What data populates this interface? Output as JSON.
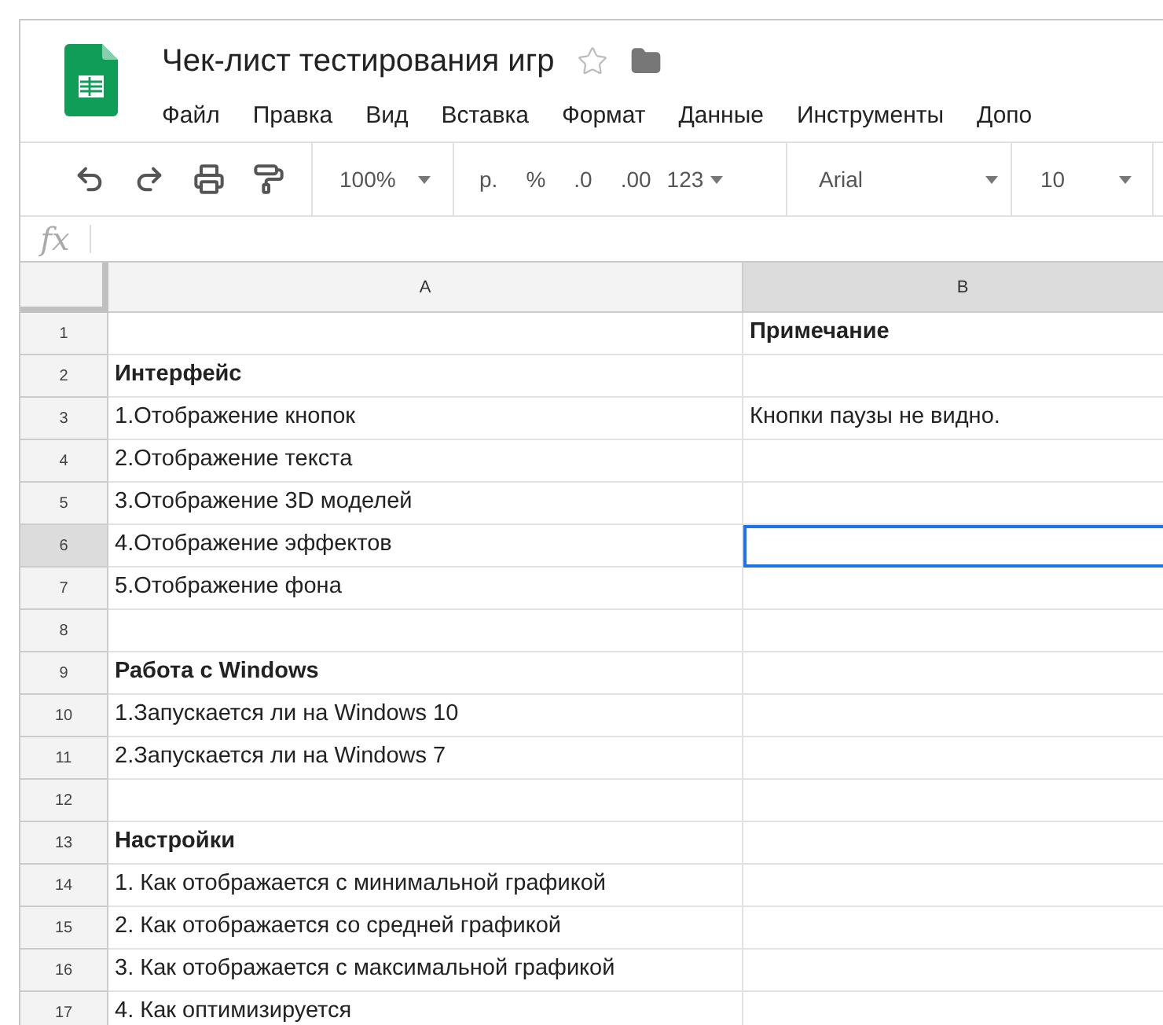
{
  "document": {
    "title": "Чек-лист тестирования игр",
    "starred": false
  },
  "menu": [
    "Файл",
    "Правка",
    "Вид",
    "Вставка",
    "Формат",
    "Данные",
    "Инструменты",
    "Допо"
  ],
  "toolbar": {
    "zoom": "100%",
    "currency": "р.",
    "percent": "%",
    "decrease_decimals": ".0",
    "increase_decimals": ".00",
    "number_format": "123",
    "font": "Arial",
    "font_size": "10"
  },
  "formula_bar": {
    "label": "fx"
  },
  "columns": [
    {
      "label": "A",
      "selected": false
    },
    {
      "label": "B",
      "selected": true
    }
  ],
  "rows": [
    {
      "number": "1",
      "kind": "heading",
      "b": "Примечание",
      "selected": false
    },
    {
      "number": "2",
      "kind": "heading",
      "a": "Интерфейс",
      "selected": false
    },
    {
      "number": "3",
      "kind": "item",
      "a": "1.Отображение кнопок",
      "b": "Кнопки паузы не видно.",
      "selected": false
    },
    {
      "number": "4",
      "kind": "item",
      "a": "2.Отображение текста",
      "selected": false
    },
    {
      "number": "5",
      "kind": "item",
      "a": "3.Отображение 3D моделей",
      "selected": false
    },
    {
      "number": "6",
      "kind": "item",
      "a": "4.Отображение эффектов",
      "selected": true
    },
    {
      "number": "7",
      "kind": "item",
      "a": "5.Отображение фона",
      "selected": false
    },
    {
      "number": "8",
      "kind": "item",
      "selected": false
    },
    {
      "number": "9",
      "kind": "heading",
      "a": "Работа с Windows",
      "selected": false
    },
    {
      "number": "10",
      "kind": "item",
      "a": "1.Запускается ли на Windows 10",
      "selected": false
    },
    {
      "number": "11",
      "kind": "item",
      "a": "2.Запускается ли на Windows 7",
      "selected": false
    },
    {
      "number": "12",
      "kind": "item",
      "selected": false
    },
    {
      "number": "13",
      "kind": "heading",
      "a": "Настройки",
      "selected": false
    },
    {
      "number": "14",
      "kind": "item",
      "a": "1. Как отображается с минимальной графикой",
      "selected": false
    },
    {
      "number": "15",
      "kind": "item",
      "a": "2. Как отображается со средней графикой",
      "selected": false
    },
    {
      "number": "16",
      "kind": "item",
      "a": "3. Как отображается с максимальной графикой",
      "selected": false
    },
    {
      "number": "17",
      "kind": "item",
      "a": "4. Как оптимизируется",
      "selected": false
    }
  ]
}
